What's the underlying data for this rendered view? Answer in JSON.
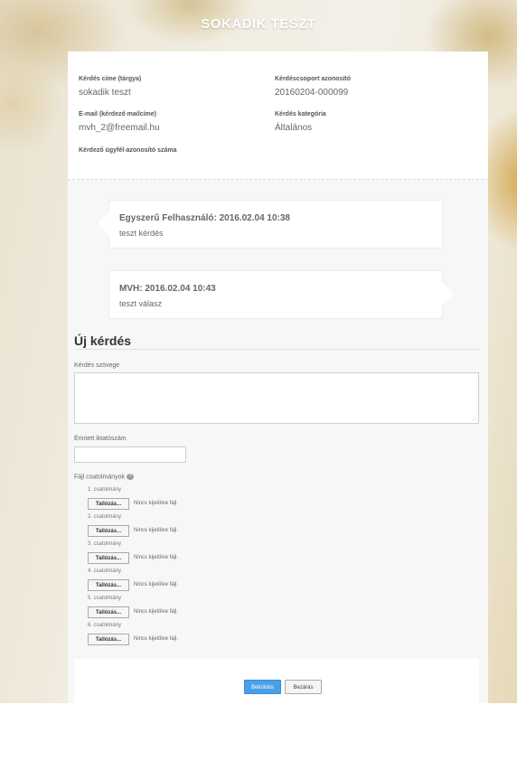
{
  "header": {
    "title": "SOKADIK TESZT"
  },
  "info": {
    "subject_label": "Kérdés címe (tárgya)",
    "subject_value": "sokadik teszt",
    "group_id_label": "Kérdéscsoport azonosító",
    "group_id_value": "20160204-000099",
    "email_label": "E-mail (kérdező mailcíme)",
    "email_value": "mvh_2@freemail.hu",
    "category_label": "Kérdés kategória",
    "category_value": "Általános",
    "client_id_label": "Kérdező ügyfél-azonosító száma"
  },
  "messages": [
    {
      "header": "Egyszerű Felhasználó: 2016.02.04 10:38",
      "body": "teszt kérdés"
    },
    {
      "header": "MVH: 2016.02.04 10:43",
      "body": "teszt válasz"
    }
  ],
  "form": {
    "title": "Új kérdés",
    "text_label": "Kérdés szövege",
    "text_value": "",
    "filing_label": "Érintett iktatószám",
    "filing_value": "",
    "attachments_label": "Fájl csatolmányok",
    "help_icon": "question-icon",
    "resize_icon": "resize-grip-icon",
    "attachments": [
      {
        "label": "1. csatolmány",
        "browse": "Tallózás...",
        "status": "Nincs kijelölve fájl."
      },
      {
        "label": "2. csatolmány",
        "browse": "Tallózás...",
        "status": "Nincs kijelölve fájl."
      },
      {
        "label": "3. csatolmány",
        "browse": "Tallózás...",
        "status": "Nincs kijelölve fájl."
      },
      {
        "label": "4. csatolmány",
        "browse": "Tallózás...",
        "status": "Nincs kijelölve fájl."
      },
      {
        "label": "5. csatolmány",
        "browse": "Tallózás...",
        "status": "Nincs kijelölve fájl."
      },
      {
        "label": "6. csatolmány",
        "browse": "Tallózás...",
        "status": "Nincs kijelölve fájl."
      }
    ],
    "submit_label": "Beküldés",
    "close_label": "Bezárás"
  },
  "colors": {
    "accent": "#4aa0e6",
    "panel_bg": "#f7f7f7",
    "title_text": "#ffffff"
  }
}
